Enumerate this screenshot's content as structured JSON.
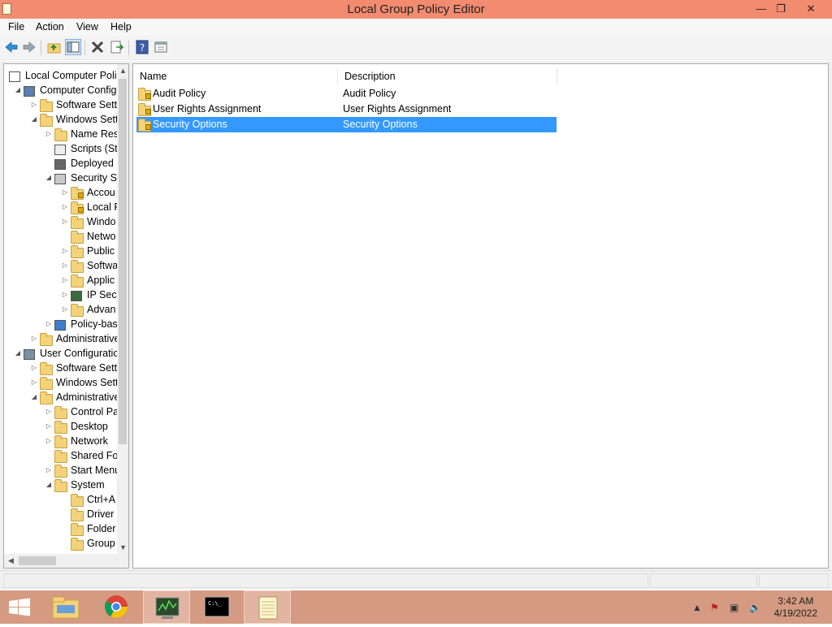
{
  "window": {
    "title": "Local Group Policy Editor",
    "minimize": "—",
    "restore": "❐",
    "close": "✕"
  },
  "menu": [
    "File",
    "Action",
    "View",
    "Help"
  ],
  "tree": [
    {
      "label": "Local Computer Polic",
      "icon": "policy-doc-icon",
      "expander": "",
      "level": 0
    },
    {
      "label": "Computer Config",
      "icon": "computer-icon",
      "expander": "open",
      "level": 1
    },
    {
      "label": "Software Setti",
      "icon": "folder-icon",
      "expander": "closed",
      "level": 2
    },
    {
      "label": "Windows Sett",
      "icon": "folder-icon",
      "expander": "open",
      "level": 2
    },
    {
      "label": "Name Res",
      "icon": "folder-icon",
      "expander": "closed",
      "level": 3
    },
    {
      "label": "Scripts (Sta",
      "icon": "script-icon",
      "expander": "",
      "level": 3
    },
    {
      "label": "Deployed",
      "icon": "printer-icon",
      "expander": "",
      "level": 3
    },
    {
      "label": "Security Se",
      "icon": "security-settings-icon",
      "expander": "open",
      "level": 3
    },
    {
      "label": "Accou",
      "icon": "locked-folder-icon",
      "expander": "closed",
      "level": 4
    },
    {
      "label": "Local P",
      "icon": "locked-folder-icon",
      "expander": "closed",
      "level": 4
    },
    {
      "label": "Windo",
      "icon": "folder-icon",
      "expander": "closed",
      "level": 4
    },
    {
      "label": "Netwo",
      "icon": "folder-icon",
      "expander": "",
      "level": 4
    },
    {
      "label": "Public",
      "icon": "folder-icon",
      "expander": "closed",
      "level": 4
    },
    {
      "label": "Softwa",
      "icon": "folder-icon",
      "expander": "closed",
      "level": 4
    },
    {
      "label": "Applic",
      "icon": "folder-icon",
      "expander": "closed",
      "level": 4
    },
    {
      "label": "IP Secu",
      "icon": "ip-security-icon",
      "expander": "closed",
      "level": 4
    },
    {
      "label": "Advan",
      "icon": "folder-icon",
      "expander": "closed",
      "level": 4
    },
    {
      "label": "Policy-bas",
      "icon": "chart-icon",
      "expander": "closed",
      "level": 3
    },
    {
      "label": "Administrative",
      "icon": "folder-icon",
      "expander": "closed",
      "level": 2
    },
    {
      "label": "User Configuratio",
      "icon": "user-icon",
      "expander": "open",
      "level": 1
    },
    {
      "label": "Software Setti",
      "icon": "folder-icon",
      "expander": "closed",
      "level": 2
    },
    {
      "label": "Windows Sett",
      "icon": "folder-icon",
      "expander": "closed",
      "level": 2
    },
    {
      "label": "Administrative",
      "icon": "folder-icon",
      "expander": "open",
      "level": 2
    },
    {
      "label": "Control Pa",
      "icon": "folder-icon",
      "expander": "closed",
      "level": 3
    },
    {
      "label": "Desktop",
      "icon": "folder-icon",
      "expander": "closed",
      "level": 3
    },
    {
      "label": "Network",
      "icon": "folder-icon",
      "expander": "closed",
      "level": 3
    },
    {
      "label": "Shared Fol",
      "icon": "folder-icon",
      "expander": "",
      "level": 3
    },
    {
      "label": "Start Menu",
      "icon": "folder-icon",
      "expander": "closed",
      "level": 3
    },
    {
      "label": "System",
      "icon": "folder-icon",
      "expander": "open",
      "level": 3
    },
    {
      "label": "Ctrl+A",
      "icon": "folder-icon",
      "expander": "",
      "level": 4
    },
    {
      "label": "Driver",
      "icon": "folder-icon",
      "expander": "",
      "level": 4
    },
    {
      "label": "Folder",
      "icon": "folder-icon",
      "expander": "",
      "level": 4
    },
    {
      "label": "Group",
      "icon": "folder-icon",
      "expander": "",
      "level": 4
    }
  ],
  "list": {
    "columns": [
      "Name",
      "Description"
    ],
    "rows": [
      {
        "name": "Audit Policy",
        "description": "Audit Policy",
        "selected": false
      },
      {
        "name": "User Rights Assignment",
        "description": "User Rights Assignment",
        "selected": false
      },
      {
        "name": "Security Options",
        "description": "Security Options",
        "selected": true
      }
    ]
  },
  "taskbar": {
    "apps": [
      "start-icon",
      "file-explorer-icon",
      "chrome-icon",
      "task-manager-icon",
      "command-prompt-icon",
      "notepad-icon"
    ],
    "time": "3:42 AM",
    "date": "4/19/2022"
  },
  "colors": {
    "title_bar": "#f28b6f",
    "selection": "#3399ff",
    "taskbar": "#d59a82"
  }
}
